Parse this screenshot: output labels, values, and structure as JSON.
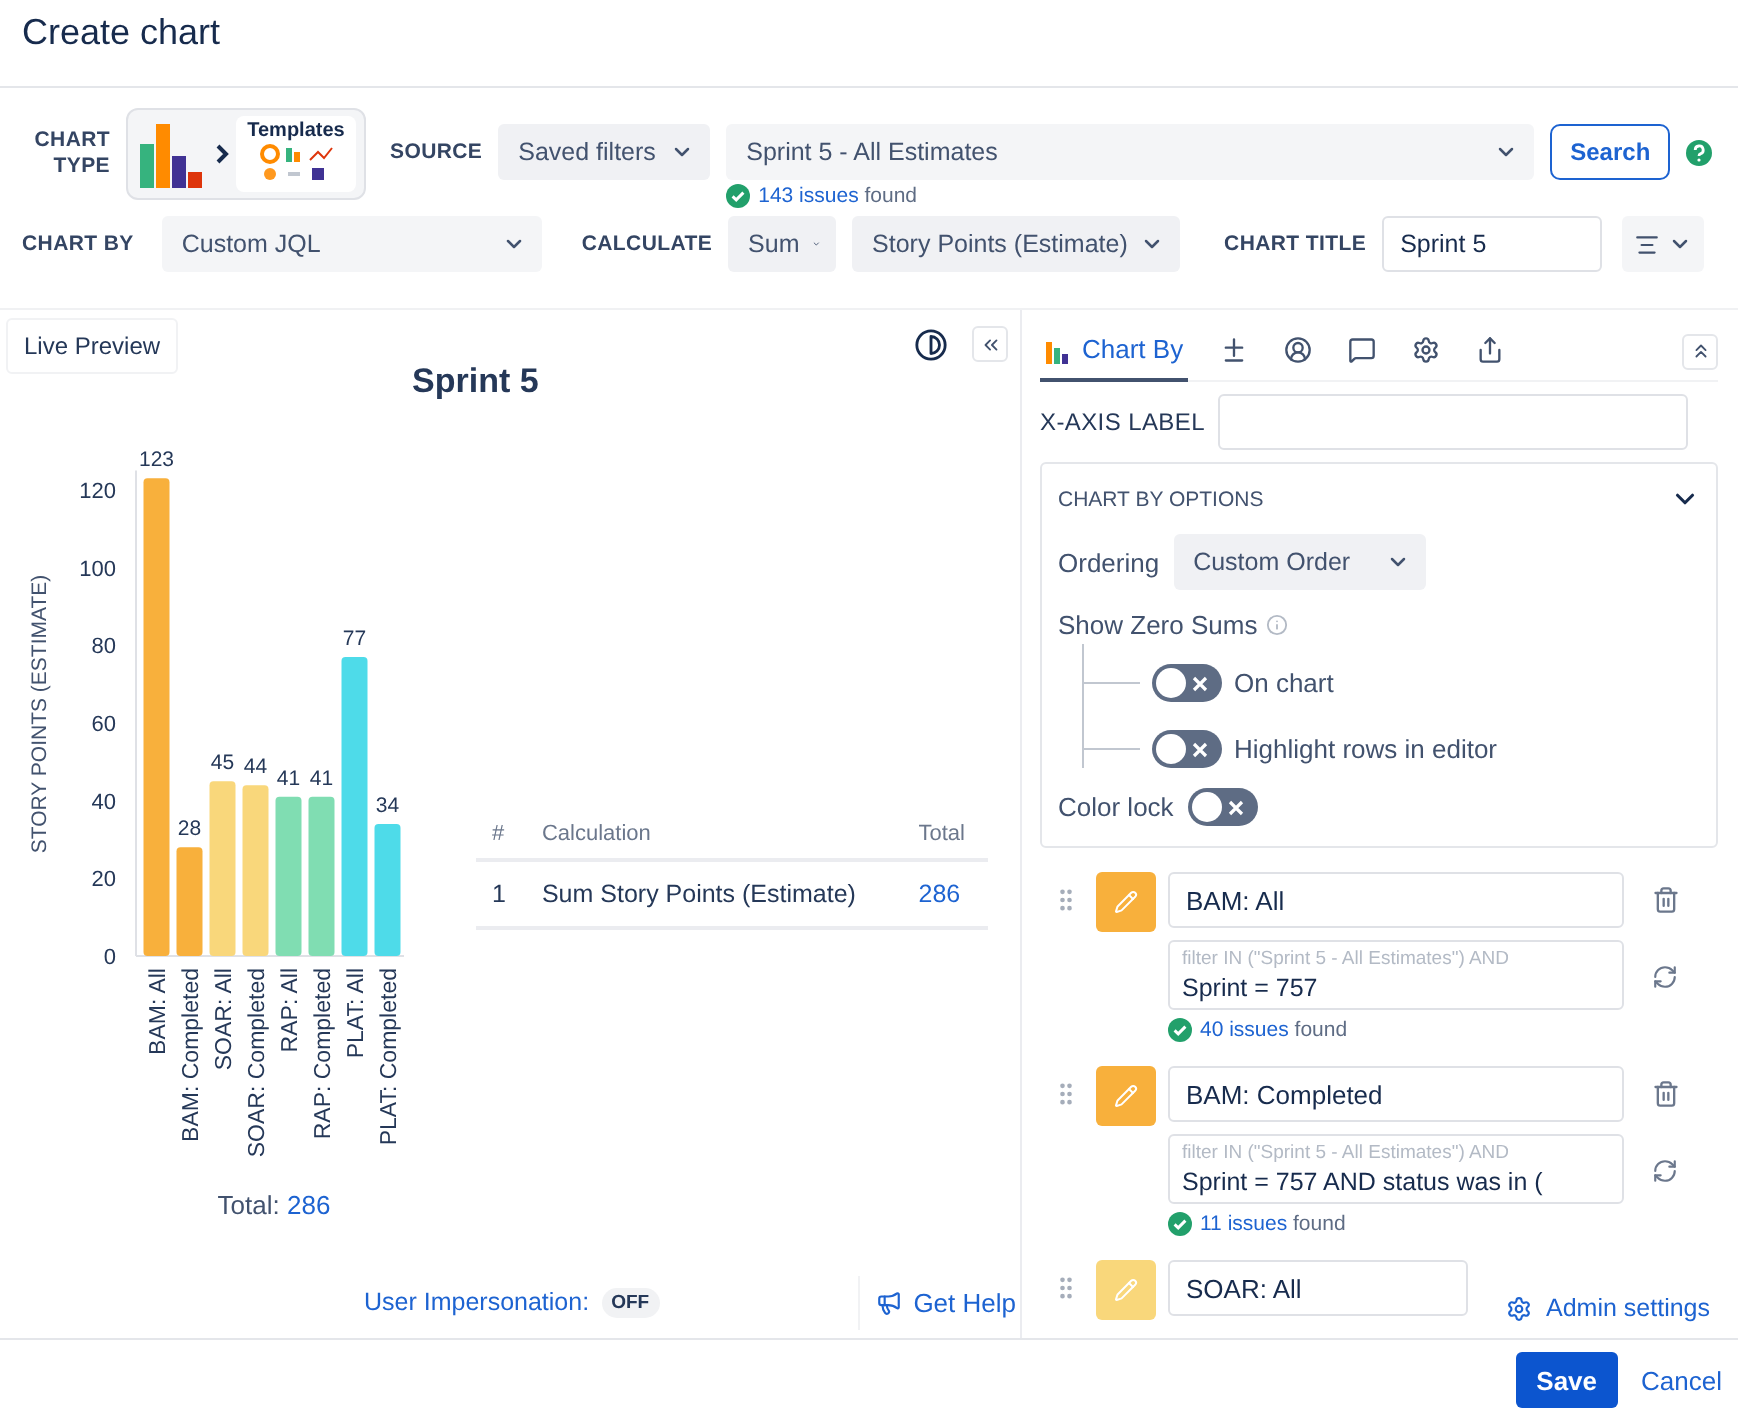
{
  "dialog": {
    "title": "Create chart"
  },
  "toolbar": {
    "chart_type": {
      "label": "CHART TYPE",
      "templates_label": "Templates"
    },
    "source": {
      "label": "SOURCE",
      "mode": "Saved filters",
      "filter": "Sprint 5 - All Estimates",
      "count": "143 issues",
      "found": "found",
      "search_button": "Search"
    },
    "chart_by": {
      "label": "CHART BY",
      "value": "Custom JQL"
    },
    "calculate": {
      "label": "CALCULATE",
      "function": "Sum",
      "field": "Story Points (Estimate)"
    },
    "chart_title": {
      "label": "CHART TITLE",
      "value": "Sprint 5"
    }
  },
  "preview": {
    "tab": "Live Preview",
    "title": "Sprint 5",
    "chart_data": {
      "type": "bar",
      "ylabel": "STORY POINTS (ESTIMATE)",
      "categories": [
        "BAM: All",
        "BAM: Completed",
        "SOAR: All",
        "SOAR: Completed",
        "RAP: All",
        "RAP: Completed",
        "PLAT: All",
        "PLAT: Completed"
      ],
      "series": [
        {
          "color": "#f8b03c",
          "values": [
            123,
            28,
            null,
            null,
            null,
            null,
            null,
            null
          ]
        },
        {
          "color": "#f9d77b",
          "values": [
            null,
            null,
            45,
            44,
            null,
            null,
            null,
            null
          ]
        },
        {
          "color": "#80ddb2",
          "values": [
            null,
            null,
            null,
            null,
            41,
            41,
            null,
            null
          ]
        },
        {
          "color": "#4edbe9",
          "values": [
            null,
            null,
            null,
            null,
            null,
            null,
            77,
            34
          ]
        }
      ],
      "stacked": true,
      "ylim": [
        0,
        125
      ],
      "yticks": [
        0,
        20,
        40,
        60,
        80,
        100,
        120
      ],
      "data_labels": true
    },
    "total_label": "Total:",
    "total_value": "286",
    "table": {
      "columns": [
        "#",
        "Calculation",
        "Total"
      ],
      "rows": [
        [
          "1",
          "Sum Story Points (Estimate)",
          "286"
        ]
      ]
    },
    "impersonation": {
      "label": "User Impersonation:",
      "value": "OFF"
    },
    "help": "Get Help"
  },
  "editor": {
    "tabs": [
      {
        "label": "Chart By",
        "selected": true
      },
      {
        "selected": false
      },
      {
        "selected": false
      },
      {
        "selected": false
      },
      {
        "selected": false
      },
      {
        "selected": false
      }
    ],
    "x_axis_label": {
      "label": "X-AXIS LABEL"
    },
    "options": {
      "title": "CHART BY OPTIONS",
      "expanded": true,
      "ordering_label": "Ordering",
      "ordering": "Custom Order",
      "zero_sums_label": "Show Zero Sums",
      "toggles": [
        {
          "label": "On chart",
          "on": false
        },
        {
          "label": "Highlight rows in editor",
          "on": false
        }
      ],
      "color_lock": {
        "label": "Color lock",
        "on": false
      }
    },
    "series": [
      {
        "name": "BAM: All",
        "filter_prefix": "filter IN (\"Sprint 5 - All Estimates\") AND",
        "query": "Sprint = 757",
        "count": "40 issues",
        "found": "found",
        "color": "#f8b03c"
      },
      {
        "name": "BAM: Completed",
        "filter_prefix": "filter IN (\"Sprint 5 - All Estimates\") AND",
        "query": "Sprint = 757 AND status was in (",
        "count": "11 issues",
        "found": "found",
        "color": "#f8b03c"
      },
      {
        "name": "SOAR: All",
        "color": "#f9d77b"
      }
    ],
    "admin_settings": "Admin settings"
  },
  "footer": {
    "save": "Save",
    "cancel": "Cancel"
  }
}
